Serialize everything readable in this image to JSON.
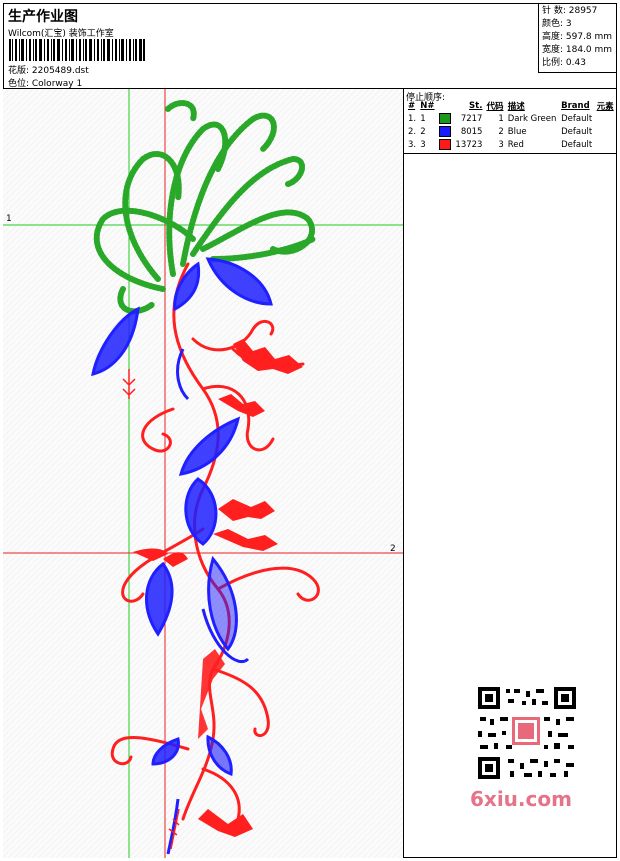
{
  "header": {
    "title": "生产作业图",
    "company": "Wilcom(汇宝) 装饰工作室",
    "design_label": "花版: 2205489.dst",
    "colorway_label": "色位: Colorway 1"
  },
  "stats": {
    "stitches": "针 数: 28957",
    "colors": "颜色: 3",
    "height": "高度: 597.8 mm",
    "width": "宽度: 184.0 mm",
    "scale": "比例: 0.43"
  },
  "panel": {
    "title": "停止顺序:",
    "headers": [
      "#",
      "N#",
      "St.",
      "代码",
      "描述",
      "Brand",
      "元素"
    ],
    "rows": [
      {
        "idx": "1.",
        "n": "1",
        "st": "7217",
        "code": "1",
        "desc": "Dark Green",
        "brand": "Default",
        "color": "#1a9a1a"
      },
      {
        "idx": "2.",
        "n": "2",
        "st": "8015",
        "code": "2",
        "desc": "Blue",
        "brand": "Default",
        "color": "#1a1aff"
      },
      {
        "idx": "3.",
        "n": "3",
        "st": "13723",
        "code": "3",
        "desc": "Red",
        "brand": "Default",
        "color": "#ff1a1a"
      }
    ]
  },
  "axes": {
    "green_label": "1",
    "red_label": "2"
  },
  "watermark": "6xiu.com",
  "colors": {
    "green": "#22bb22",
    "blue": "#1a1aff",
    "red": "#ff1a1a"
  }
}
